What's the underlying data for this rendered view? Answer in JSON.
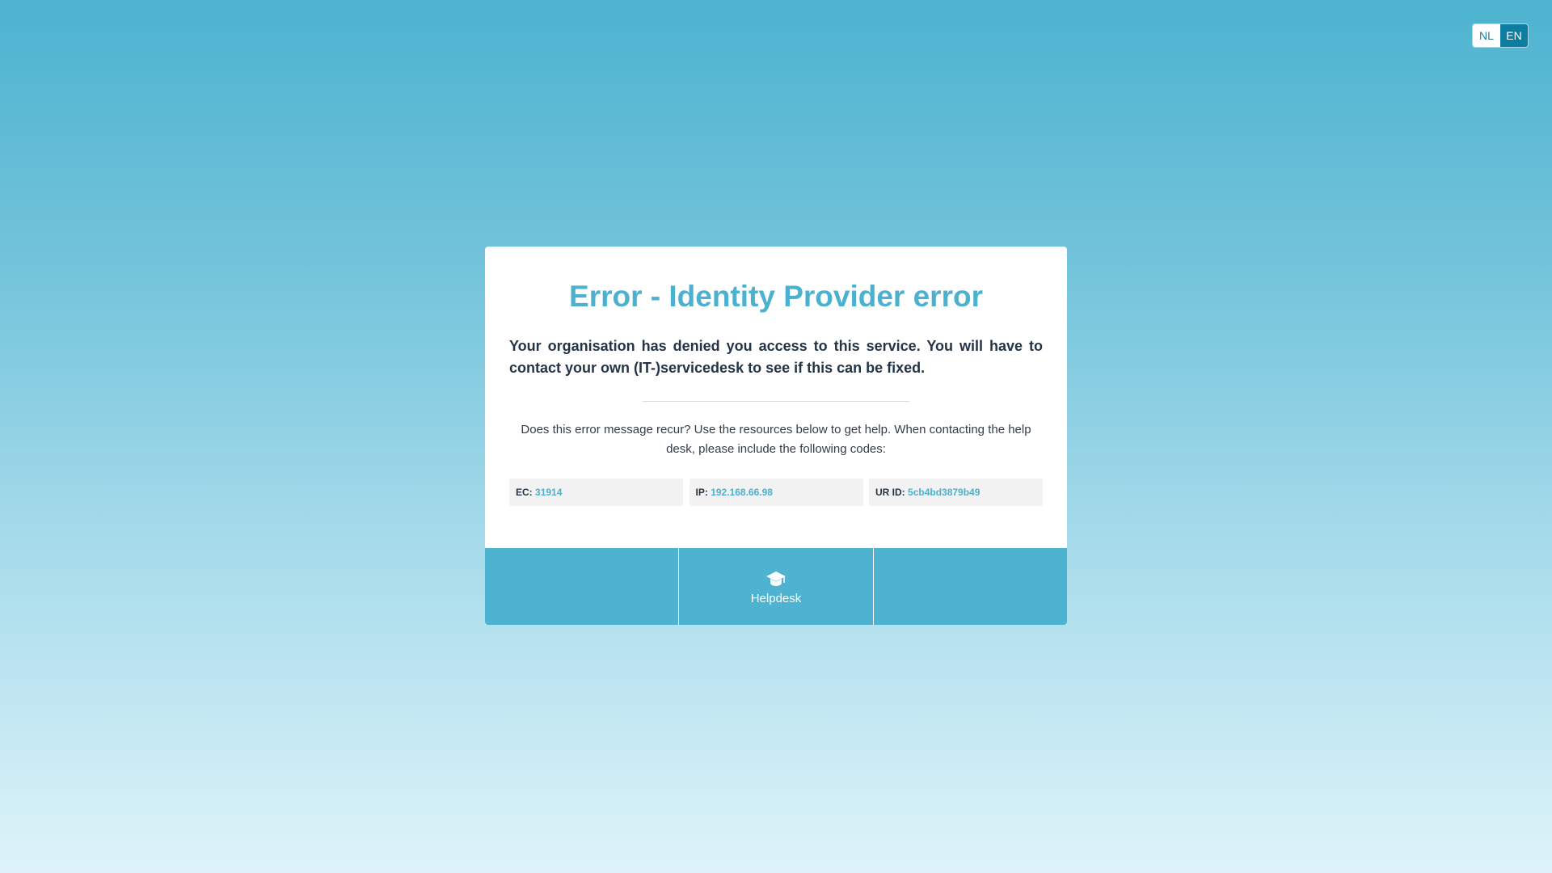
{
  "language_switch": {
    "options": [
      {
        "label": "NL",
        "selected": false
      },
      {
        "label": "EN",
        "selected": true
      }
    ]
  },
  "card": {
    "title": "Error - Identity Provider error",
    "message": "Your organisation has denied you access to this service. You will have to contact your own (IT-)servicedesk to see if this can be fixed.",
    "help_text": "Does this error message recur? Use the resources below to get help. When contacting the help desk, please include the following codes:",
    "codes": [
      {
        "label": "EC:",
        "value": "31914"
      },
      {
        "label": "IP:",
        "value": "192.168.66.98"
      },
      {
        "label": "UR ID:",
        "value": "5cb4bd3879b49"
      }
    ]
  },
  "footer": {
    "helpdesk_label": "Helpdesk",
    "helpdesk_icon": "graduation-cap-icon"
  },
  "colors": {
    "accent": "#4cb0cf",
    "footer_bg": "#4db3d1",
    "active_language": "#0f7d9f",
    "text_dark": "#243447"
  }
}
